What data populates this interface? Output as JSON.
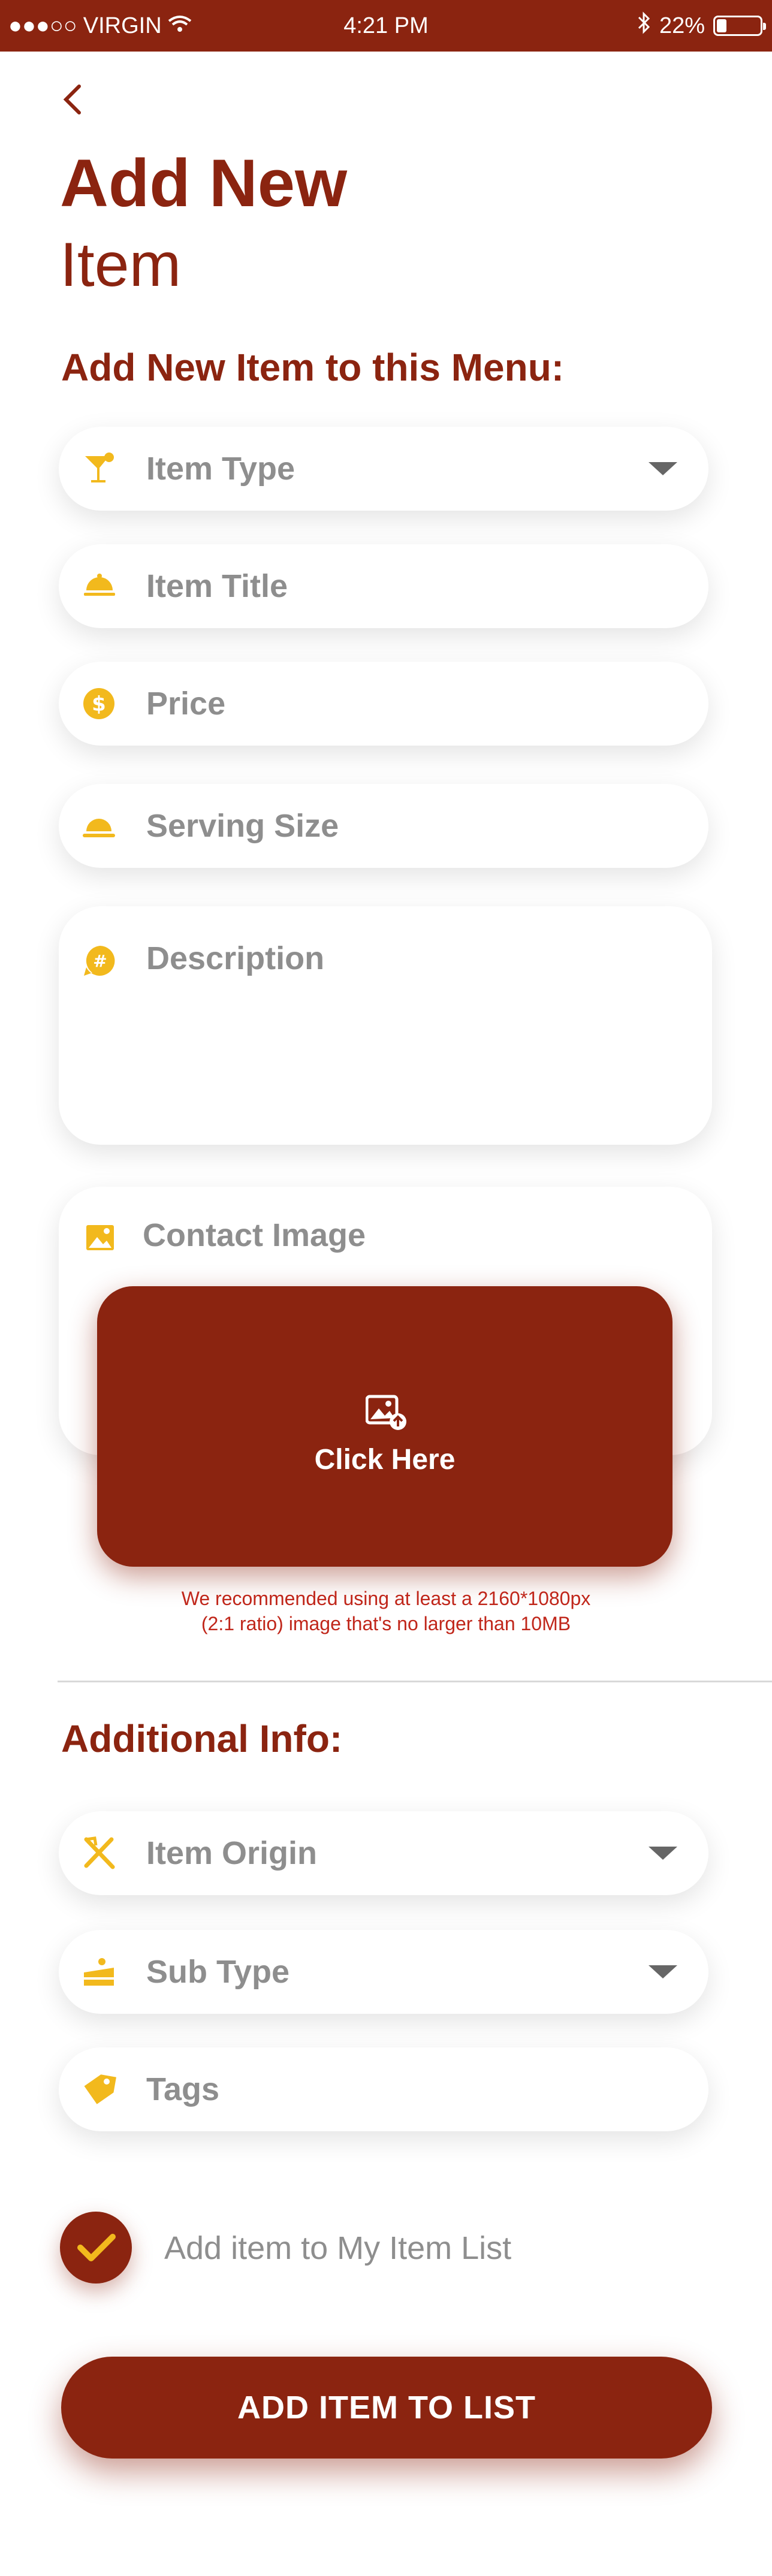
{
  "status": {
    "carrier": "VIRGIN",
    "time": "4:21 PM",
    "battery": "22%"
  },
  "header": {
    "title_line1": "Add New",
    "title_line2": "Item"
  },
  "form": {
    "section_title": "Add New Item to this Menu:",
    "item_type": "Item Type",
    "item_title": "Item Title",
    "price": "Price",
    "serving_size": "Serving Size",
    "description": "Description",
    "contact_image": "Contact Image",
    "upload_label": "Click Here",
    "hint_line1": "We recommended using at least a 2160*1080px",
    "hint_line2": "(2:1 ratio) image that's no larger than 10MB"
  },
  "additional": {
    "section_title": "Additional Info:",
    "item_origin": "Item Origin",
    "sub_type": "Sub Type",
    "tags": "Tags"
  },
  "checkbox": {
    "label": "Add item to My Item List",
    "checked": true
  },
  "cta": {
    "label": "ADD ITEM TO LIST"
  },
  "colors": {
    "brand": "#8b2410",
    "accent": "#f2b91d",
    "muted": "#8e8e8e",
    "hint": "#c0261a"
  },
  "icons": [
    "cocktail-icon",
    "cloche-icon",
    "dollar-icon",
    "serving-dish-icon",
    "hash-icon",
    "image-icon",
    "upload-image-icon",
    "utensils-icon",
    "cake-icon",
    "tag-icon",
    "check-icon"
  ]
}
